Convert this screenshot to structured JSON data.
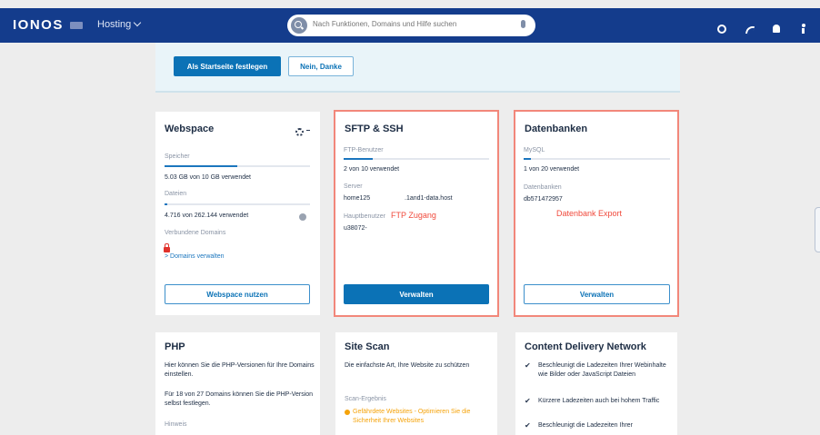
{
  "header": {
    "logo": "IONOS",
    "product": "Hosting",
    "search_placeholder": "Nach Funktionen, Domains und Hilfe suchen"
  },
  "banner": {
    "primary_label": "Als Startseite festlegen",
    "secondary_label": "Nein, Danke"
  },
  "webspace": {
    "title": "Webspace",
    "storage_label": "Speicher",
    "storage_value": "5.03 GB von 10 GB verwendet",
    "storage_fraction": 0.5,
    "files_label": "Dateien",
    "files_value": "4.716 von 262.144 verwendet",
    "files_fraction": 0.02,
    "domains_label": "Verbundene Domains",
    "domains_link": "> Domains verwalten",
    "button_label": "Webspace nutzen"
  },
  "sftp": {
    "title": "SFTP & SSH",
    "users_label": "FTP-Benutzer",
    "users_value": "2 von 10 verwendet",
    "users_fraction": 0.2,
    "server_label": "Server",
    "server_host": "home125",
    "server_domain": ".1and1-data.host",
    "main_user_label": "Hauptbenutzer",
    "main_user_value": "u38072-",
    "annotation": "FTP Zugang",
    "button_label": "Verwalten"
  },
  "databases": {
    "title": "Datenbanken",
    "mysql_label": "MySQL",
    "mysql_value": "1 von 20 verwendet",
    "mysql_fraction": 0.05,
    "db_label": "Datenbanken",
    "db_value": "db571472957",
    "annotation": "Datenbank Export",
    "button_label": "Verwalten"
  },
  "php": {
    "title": "PHP",
    "text1": "Hier können Sie die PHP-Versionen für Ihre Domains einstellen.",
    "text2": "Für 18 von 27 Domains können Sie die PHP-Version selbst festlegen.",
    "hint_label": "Hinweis"
  },
  "sitescan": {
    "title": "Site Scan",
    "text": "Die einfachste Art, Ihre Website zu schützen",
    "result_label": "Scan-Ergebnis",
    "warning": "Gefährdete Websites - Optimieren Sie die Sicherheit Ihrer Websites"
  },
  "cdn": {
    "title": "Content Delivery Network",
    "items": [
      "Beschleunigt die Ladezeiten Ihrer Webinhalte wie Bilder oder JavaScript Dateien",
      "Kürzere Ladezeiten auch bei hohem Traffic",
      "Beschleunigt die Ladezeiten Ihrer"
    ]
  }
}
